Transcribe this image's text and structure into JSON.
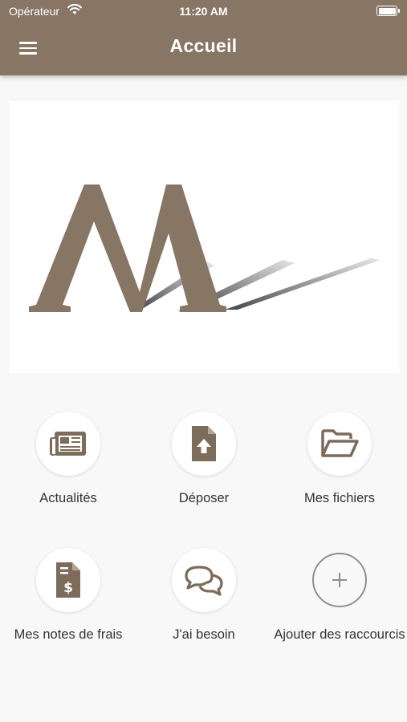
{
  "status_bar": {
    "carrier": "Opérateur",
    "time": "11:20 AM"
  },
  "header": {
    "title": "Accueil"
  },
  "colors": {
    "brand": "#877664",
    "icon": "#7d6c59",
    "background": "#f8f8f8"
  },
  "shortcuts": [
    {
      "label": "Actualités",
      "icon": "newspaper-icon"
    },
    {
      "label": "Déposer",
      "icon": "file-upload-icon"
    },
    {
      "label": "Mes fichiers",
      "icon": "folder-open-icon"
    },
    {
      "label": "Mes notes de frais",
      "icon": "expense-receipt-icon"
    },
    {
      "label": "J'ai besoin",
      "icon": "chat-bubbles-icon"
    },
    {
      "label": "Ajouter des raccourcis",
      "icon": "plus-icon"
    }
  ]
}
